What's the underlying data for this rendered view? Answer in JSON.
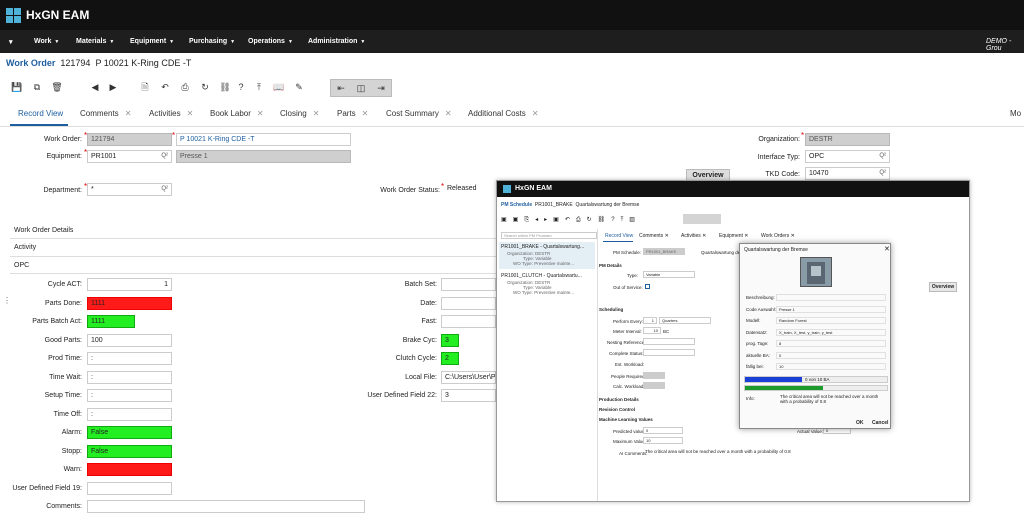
{
  "app": {
    "title": "HxGN EAM",
    "user": "DEMO - Grou"
  },
  "nav": [
    "Work",
    "Materials",
    "Equipment",
    "Purchasing",
    "Operations",
    "Administration"
  ],
  "header": {
    "title": "Work Order",
    "number": "121794",
    "description": "P 10021 K-Ring CDE -T"
  },
  "tabs": [
    "Record View",
    "Comments",
    "Activities",
    "Book Labor",
    "Closing",
    "Parts",
    "Cost Summary",
    "Additional Costs",
    "Mo"
  ],
  "form": {
    "work_order_label": "Work Order:",
    "work_order": "121794",
    "wo_desc": "P 10021 K-Ring CDE -T",
    "equipment_label": "Equipment:",
    "equipment": "PR1001",
    "equipment_desc": "Presse 1",
    "department_label": "Department:",
    "department": "*",
    "status_label": "Work Order Status:",
    "status": "Released",
    "organization_label": "Organization:",
    "organization": "DESTR",
    "interface_label": "Interface Typ:",
    "interface": "OPC",
    "tkd_label": "TKD Code:",
    "tkd": "10470",
    "overview_btn": "Overview"
  },
  "sections": {
    "details": "Work Order Details",
    "activity": "Activity",
    "opc": "OPC"
  },
  "opc_left": [
    {
      "label": "Cycle ACT:",
      "value": "1",
      "state": "normal"
    },
    {
      "label": "Parts Done:",
      "value": "1111",
      "state": "red"
    },
    {
      "label": "Parts Batch Act:",
      "value": "1111",
      "state": "green-short"
    },
    {
      "label": "Good Parts:",
      "value": "100",
      "state": "normal"
    },
    {
      "label": "Prod Time:",
      "value": ":",
      "state": "normal"
    },
    {
      "label": "Time Wait:",
      "value": ":",
      "state": "normal"
    },
    {
      "label": "Setup Time:",
      "value": ":",
      "state": "normal"
    },
    {
      "label": "Time Off:",
      "value": ":",
      "state": "normal"
    },
    {
      "label": "Alarm:",
      "value": "False",
      "state": "green"
    },
    {
      "label": "Stopp:",
      "value": "False",
      "state": "green"
    },
    {
      "label": "Warn:",
      "value": "",
      "state": "red"
    },
    {
      "label": "User Defined Field 19:",
      "value": "",
      "state": "normal"
    },
    {
      "label": "Comments:",
      "value": "",
      "state": "normal"
    }
  ],
  "opc_right": [
    {
      "label": "Batch Set:",
      "value": "",
      "state": "normal"
    },
    {
      "label": "Date:",
      "value": "",
      "state": "normal"
    },
    {
      "label": "Fast:",
      "value": "",
      "state": "normal"
    },
    {
      "label": "Brake Cyc:",
      "value": "3",
      "state": "green-short"
    },
    {
      "label": "Clutch Cycle:",
      "value": "2",
      "state": "green-short"
    },
    {
      "label": "Local File:",
      "value": "C:\\Users\\User\\Pic",
      "state": "normal"
    },
    {
      "label": "User Defined Field 22:",
      "value": "3",
      "state": "normal"
    }
  ],
  "overlay": {
    "title": "HxGN EAM",
    "header": "PM Schedule",
    "header_no": "PR1001_BRAKE",
    "header_desc": "Quartalswartung der Bremse",
    "search_placeholder": "Search within PM Proaram",
    "list": [
      {
        "title": "PR1001_BRAKE - Quartalswartung...",
        "org": "DESTR",
        "type": "Variable",
        "wo": "Preventive mainte..."
      },
      {
        "title": "PR1001_CLUTCH - Quartalswartu...",
        "org": "DESTR",
        "type": "Variable",
        "wo": "Preventive mainte..."
      }
    ],
    "list_keys": {
      "org": "Organization:",
      "type": "Type:",
      "wo": "WO Type:"
    },
    "tabs": [
      "Record View",
      "Comments",
      "Activities",
      "Equipment",
      "Work Orders"
    ],
    "pm_schedule_label": "PM Schedule:",
    "pm_schedule": "PR1001_BRAKE",
    "pm_desc": "Quartalswartung der",
    "pm_details": "PM Details",
    "type_label": "Type:",
    "type": "Variable",
    "oos_label": "Out of Service:",
    "scheduling": "Scheduling",
    "perform_every_label": "Perform Every:",
    "perform_every": "1",
    "perform_unit": "Quarters",
    "meter_label": "Meter Interval:",
    "meter": "10",
    "meter_unit": "BC",
    "nesting_label": "Nesting Reference:",
    "complete_label": "Complete Status:",
    "est_label": "Est. Workload:",
    "people_label": "People Required:",
    "calc_label": "Calc. Workload:",
    "production_details": "Production Details",
    "revision_control": "Revision Control",
    "ml_values": "Machine Learning Values",
    "predicted_label": "Predicted value:",
    "predicted": "0",
    "actual_label": "Actual Value:",
    "actual": "0",
    "max_label": "Maximum Value:",
    "max": "10",
    "ai_label": "AI Comments:",
    "ai": "The critical area will not be reached over a month with a probability of 0.8",
    "overview_btn": "Overview"
  },
  "dialog": {
    "title": "Quartalswartung der Bremse",
    "rows": [
      {
        "label": "Beschreibung:",
        "value": ""
      },
      {
        "label": "Code Auswahl:",
        "value": "Presse 1"
      },
      {
        "label": "Modell:",
        "value": "Random Forest"
      },
      {
        "label": "Datensatz:",
        "value": "X_train, X_test, y_train, y_test"
      },
      {
        "label": "prog. Tage:",
        "value": "8"
      },
      {
        "label": "aktuelle BA:",
        "value": "0"
      },
      {
        "label": "fällig bei:",
        "value": "10"
      }
    ],
    "progress1_text": "0 von 10 BA",
    "progress1_fraction": 0.4,
    "progress2_fraction": 0.55,
    "info_label": "Info:",
    "info": "The critical area will not be reached over a month with a probability of 0.8",
    "ok": "OK",
    "cancel": "Cancel"
  }
}
